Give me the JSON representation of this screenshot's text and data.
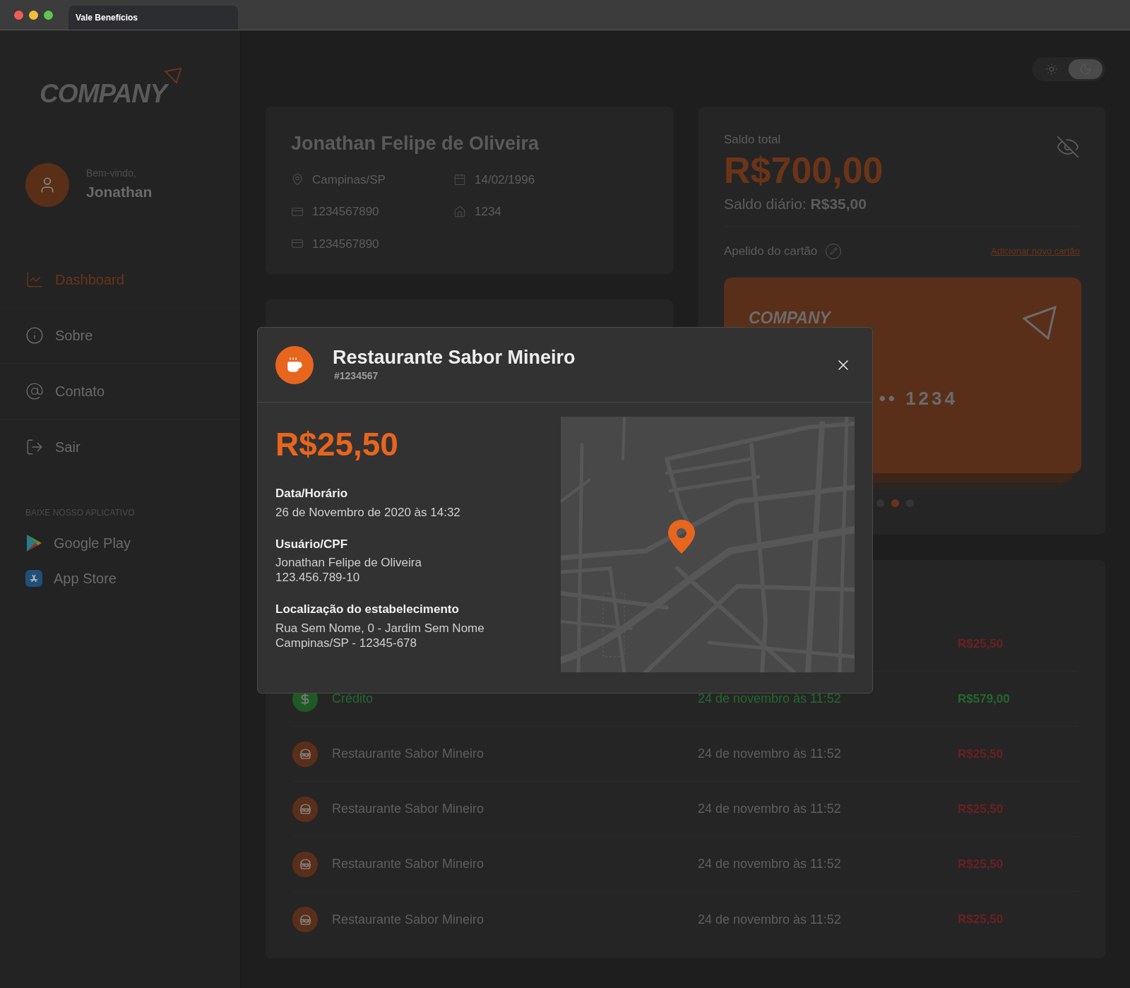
{
  "window": {
    "tab_title": "Vale Benefícios"
  },
  "sidebar": {
    "logo": "COMPANY",
    "greeting": "Bem-vindo,",
    "user_name": "Jonathan",
    "nav": [
      {
        "kind": "dashboard",
        "label": "Dashboard",
        "selected": true
      },
      {
        "kind": "about",
        "label": "Sobre",
        "selected": false
      },
      {
        "kind": "contact",
        "label": "Contato",
        "selected": false
      },
      {
        "kind": "logout",
        "label": "Sair",
        "selected": false
      }
    ],
    "apps_heading": "BAIXE NOSSO APLICATIVO",
    "apps": [
      {
        "kind": "google",
        "label": "Google Play"
      },
      {
        "kind": "apple",
        "label": "App Store"
      }
    ]
  },
  "theme_toggle": [
    {
      "kind": "light",
      "selected": false
    },
    {
      "kind": "dark",
      "selected": true
    }
  ],
  "profile": {
    "name": "Jonathan Felipe de Oliveira",
    "fields": [
      {
        "kind": "location",
        "value": "Campinas/SP"
      },
      {
        "kind": "date",
        "value": "14/02/1996"
      },
      {
        "kind": "card",
        "value": "1234567890"
      },
      {
        "kind": "home",
        "value": "1234"
      },
      {
        "kind": "card",
        "value": "1234567890"
      }
    ]
  },
  "balance": {
    "label": "Saldo total",
    "amount": "R$700,00",
    "daily": "Saldo diário: **R$35,00**",
    "card_nickname": "Apelido do cartão",
    "add_card_link": "Adicionar novo cartão",
    "card": {
      "logo": "COMPANY",
      "number": "•• 1234"
    },
    "dots": [
      {
        "selected": false
      },
      {
        "selected": true
      },
      {
        "selected": false
      }
    ]
  },
  "transactions": [
    {
      "kind": "expense",
      "amount": "R$25,50"
    },
    {
      "kind": "credit",
      "name": "Crédito",
      "date": "24 de novembro às 11:52",
      "amount": "R$579,00"
    },
    {
      "kind": "expense",
      "name": "Restaurante Sabor Mineiro",
      "date": "24 de novembro às 11:52",
      "amount": "R$25,50"
    },
    {
      "kind": "expense",
      "name": "Restaurante Sabor Mineiro",
      "date": "24 de novembro às 11:52",
      "amount": "R$25,50"
    },
    {
      "kind": "expense",
      "name": "Restaurante Sabor Mineiro",
      "date": "24 de novembro às 11:52",
      "amount": "R$25,50"
    },
    {
      "kind": "expense",
      "name": "Restaurante Sabor Mineiro",
      "date": "24 de novembro às 11:52",
      "amount": "R$25,50"
    }
  ],
  "modal": {
    "title": "Restaurante Sabor Mineiro",
    "code": "#1234567",
    "amount": "R$25,50",
    "details": [
      {
        "label": "Data/Horário",
        "lines": [
          "26 de Novembro de 2020 às 14:32"
        ]
      },
      {
        "label": "Usuário/CPF",
        "lines": [
          "Jonathan Felipe de Oliveira",
          "123.456.789-10"
        ]
      },
      {
        "label": "Localização do estabelecimento",
        "lines": [
          "Rua Sem Nome, 0 - Jardim Sem Nome",
          "Campinas/SP - 12345-678"
        ]
      }
    ]
  }
}
